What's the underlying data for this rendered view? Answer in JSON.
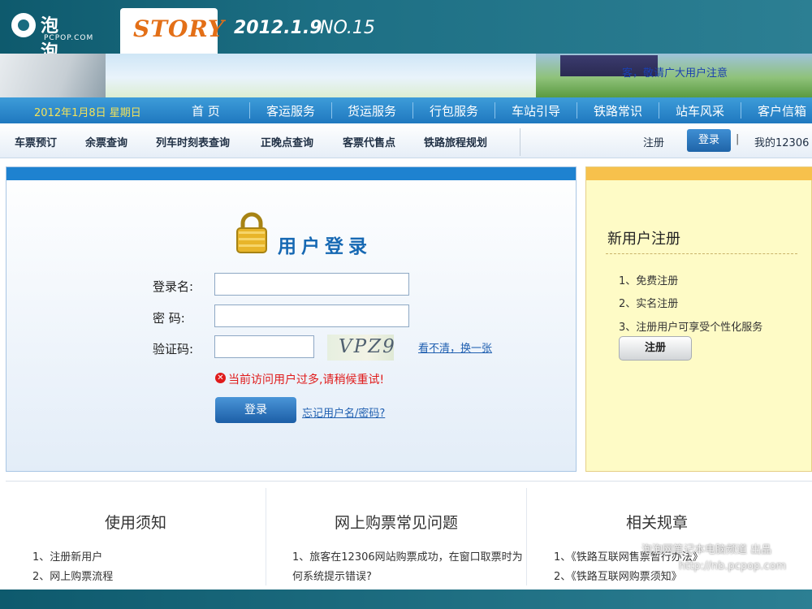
{
  "magazine": {
    "logo_cn": "泡泡网",
    "logo_en": "PCPOP.COM",
    "section": "STORY",
    "date": "2012.1.9",
    "issue": "NO.15"
  },
  "banner": {
    "marquee": "客，敬请广大用户注意"
  },
  "nav": {
    "date": "2012年1月8日 星期日",
    "items": [
      "首 页",
      "客运服务",
      "货运服务",
      "行包服务",
      "车站引导",
      "铁路常识",
      "站车风采",
      "客户信箱"
    ]
  },
  "subnav": {
    "items": [
      "车票预订",
      "余票查询",
      "列车时刻表查询",
      "正晚点查询",
      "客票代售点",
      "铁路旅程规划"
    ],
    "register": "注册",
    "login": "登录",
    "pipe": "|",
    "my12306": "我的12306"
  },
  "login": {
    "title": "用户登录",
    "username_label": "登录名:",
    "password_label": "密  码:",
    "captcha_label": "验证码:",
    "captcha_value": "VPZ9",
    "captcha_refresh": "看不清，换一张",
    "error_message": "当前访问用户过多,请稍候重试!",
    "submit": "登录",
    "forgot": "忘记用户名/密码?"
  },
  "register": {
    "title": "新用户注册",
    "items": [
      "1、免费注册",
      "2、实名注册",
      "3、注册用户可享受个性化服务"
    ],
    "button": "注册"
  },
  "info": {
    "notice": {
      "title": "使用须知",
      "items": [
        "1、注册新用户",
        "2、网上购票流程"
      ]
    },
    "faq": {
      "title": "网上购票常见问题",
      "items": [
        "1、旅客在12306网站购票成功，在窗口取票时为",
        "何系统提示错误?"
      ]
    },
    "rules": {
      "title": "相关规章",
      "items": [
        "1、《铁路互联网售票暂行办法》",
        "2、《铁路互联网购票须知》"
      ]
    }
  },
  "watermark": {
    "line1": "泡泡网笔记本电脑频道 出品",
    "line2": "http://nb.pcpop.com"
  },
  "colors": {
    "nav_blue": "#1f78bf",
    "error_red": "#e01b1b",
    "link_blue": "#1f5fb0",
    "register_yellow": "#fefbc6"
  }
}
